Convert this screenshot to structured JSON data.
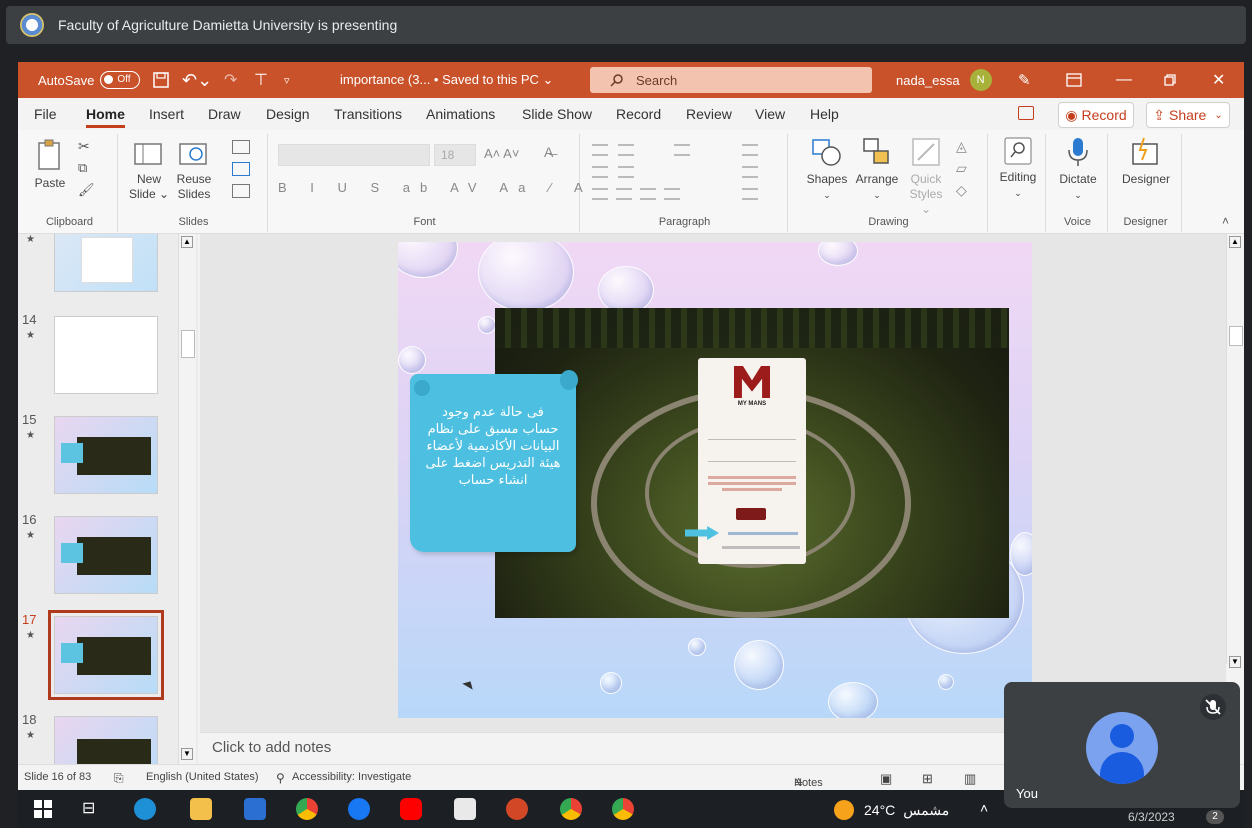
{
  "meet": {
    "presenting_title": "Faculty of Agriculture Damietta University is presenting",
    "self_name": "You"
  },
  "titlebar": {
    "autosave_label": "AutoSave",
    "autosave_state": "Off",
    "doc_title": "importance (3...  • Saved to this PC ⌄",
    "search_placeholder": "Search",
    "user_name": "nada_essa",
    "user_initial": "N"
  },
  "menu": {
    "tabs": [
      "File",
      "Home",
      "Insert",
      "Draw",
      "Design",
      "Transitions",
      "Animations",
      "Slide Show",
      "Record",
      "Review",
      "View",
      "Help"
    ],
    "active_tab": "Home",
    "record_label": "Record",
    "share_label": "Share"
  },
  "ribbon": {
    "paste": "Paste",
    "new_slide_1": "New",
    "new_slide_2": "Slide ⌄",
    "reuse_1": "Reuse",
    "reuse_2": "Slides",
    "font_size": "18",
    "shapes": "Shapes",
    "arrange": "Arrange",
    "quick_styles_1": "Quick",
    "quick_styles_2": "Styles ⌄",
    "editing": "Editing",
    "dictate": "Dictate",
    "designer": "Designer",
    "groups": {
      "clipboard": "Clipboard",
      "slides": "Slides",
      "font": "Font",
      "paragraph": "Paragraph",
      "drawing": "Drawing",
      "voice": "Voice",
      "designer": "Designer"
    }
  },
  "thumbnails": {
    "items": [
      {
        "num": "14"
      },
      {
        "num": "15"
      },
      {
        "num": "16"
      },
      {
        "num": "17"
      },
      {
        "num": "18"
      }
    ],
    "selected": "17"
  },
  "slide": {
    "banner_text": "فى حالة عدم وجود حساب مسبق على نظام البيانات الأكاديمية لأعضاء هيئة التدريس اضغط على انشاء حساب",
    "card_caption": "MY MANS"
  },
  "notes": {
    "placeholder": "Click to add notes"
  },
  "status": {
    "slide_info": "Slide 16 of 83",
    "language": "English (United States)",
    "accessibility": "Accessibility: Investigate",
    "notes_btn": "Notes"
  },
  "taskbar": {
    "temperature": "24°C",
    "weather_text": "مشمس",
    "date": "6/3/2023"
  },
  "colors": {
    "ppt_accent": "#c43e1c",
    "titlebar": "#c9522a",
    "banner": "#4dbfe0"
  }
}
